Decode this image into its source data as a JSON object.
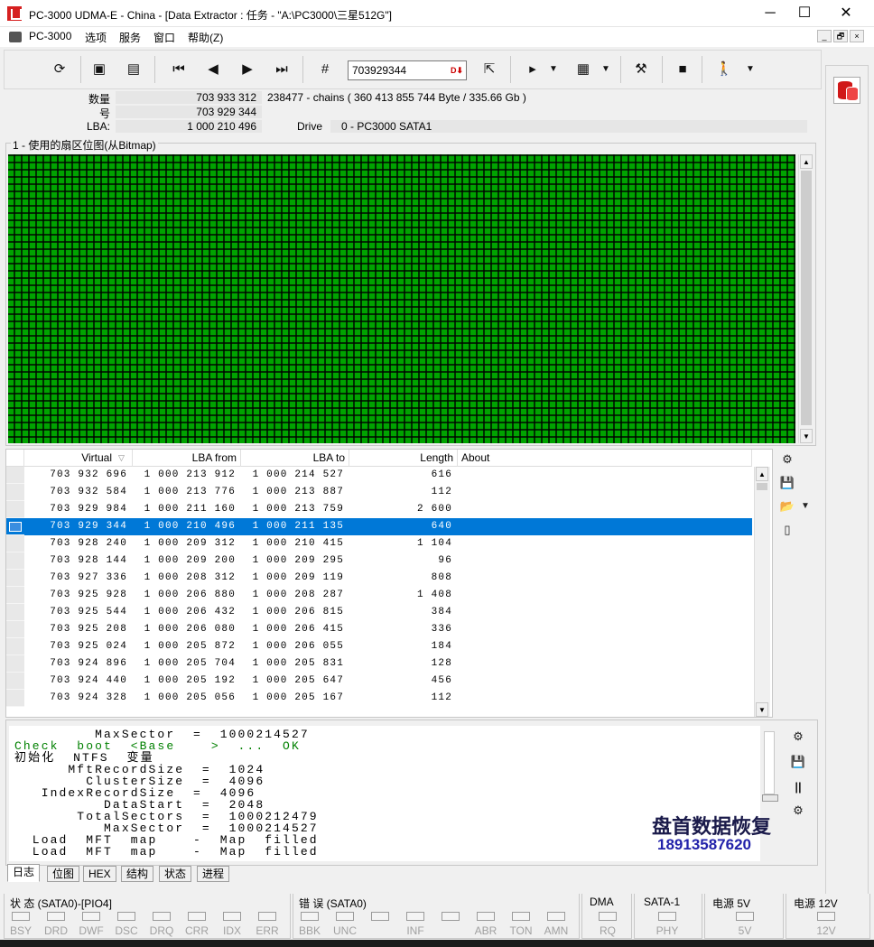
{
  "window": {
    "title": "PC-3000 UDMA-E - China - [Data Extractor : 任务 - \"A:\\PC3000\\三星512G\"]",
    "minimize": "─",
    "maximize": "☐",
    "close": "✕"
  },
  "menu": {
    "items": [
      "PC-3000",
      "选项",
      "服务",
      "窗口",
      "帮助(Z)"
    ],
    "mdi": [
      "_",
      "🗗",
      "×"
    ]
  },
  "toolbar": {
    "goto_value": "703929344",
    "goto_icon": "D⬇",
    "icons": [
      "refresh-scan-icon",
      "save-disk-icon",
      "save-disk-multi-icon",
      "first-icon",
      "prev-icon",
      "next-icon",
      "last-icon",
      "goto-number-icon",
      "export-icon",
      "play-icon",
      "grid-icon",
      "tools-icon",
      "stop-icon",
      "exit-icon"
    ]
  },
  "info": {
    "count_label": "数量",
    "count_value": "703 933 312",
    "count_extra": "238477 - chains  ( 360 413 855 744 Byte /  335.66 Gb )",
    "num_label": "号",
    "num_value": "703 929 344",
    "lba_label": "LBA:",
    "lba_value": "1 000 210 496",
    "drive_label": "Drive",
    "drive_value": "0 - PC3000 SATA1"
  },
  "bitmap": {
    "title": "1 - 使用的扇区位图(从Bitmap)",
    "fill_fraction": 1.0,
    "color": "#00cc00"
  },
  "table": {
    "columns": [
      "Virtual",
      "LBA from",
      "LBA to",
      "Length",
      "About"
    ],
    "selected_index": 3,
    "rows": [
      [
        "703 932 696",
        "1 000 213 912",
        "1 000 214 527",
        "616",
        ""
      ],
      [
        "703 932 584",
        "1 000 213 776",
        "1 000 213 887",
        "112",
        ""
      ],
      [
        "703 929 984",
        "1 000 211 160",
        "1 000 213 759",
        "2 600",
        ""
      ],
      [
        "703 929 344",
        "1 000 210 496",
        "1 000 211 135",
        "640",
        ""
      ],
      [
        "703 928 240",
        "1 000 209 312",
        "1 000 210 415",
        "1 104",
        ""
      ],
      [
        "703 928 144",
        "1 000 209 200",
        "1 000 209 295",
        "96",
        ""
      ],
      [
        "703 927 336",
        "1 000 208 312",
        "1 000 209 119",
        "808",
        ""
      ],
      [
        "703 925 928",
        "1 000 206 880",
        "1 000 208 287",
        "1 408",
        ""
      ],
      [
        "703 925 544",
        "1 000 206 432",
        "1 000 206 815",
        "384",
        ""
      ],
      [
        "703 925 208",
        "1 000 206 080",
        "1 000 206 415",
        "336",
        ""
      ],
      [
        "703 925 024",
        "1 000 205 872",
        "1 000 206 055",
        "184",
        ""
      ],
      [
        "703 924 896",
        "1 000 205 704",
        "1 000 205 831",
        "128",
        ""
      ],
      [
        "703 924 440",
        "1 000 205 192",
        "1 000 205 647",
        "456",
        ""
      ],
      [
        "703 924 328",
        "1 000 205 056",
        "1 000 205 167",
        "112",
        ""
      ]
    ]
  },
  "log": {
    "lines": [
      {
        "text": "         MaxSector  =  1000214527",
        "color": "black"
      },
      {
        "text": "Check  boot  <Base    >  ...  OK",
        "color": "green"
      },
      {
        "text": "初始化  NTFS  变量",
        "color": "black"
      },
      {
        "text": "      MftRecordSize  =  1024",
        "color": "black"
      },
      {
        "text": "        ClusterSize  =  4096",
        "color": "black"
      },
      {
        "text": "   IndexRecordSize  =  4096",
        "color": "black"
      },
      {
        "text": "          DataStart  =  2048",
        "color": "black"
      },
      {
        "text": "       TotalSectors  =  1000212479",
        "color": "black"
      },
      {
        "text": "          MaxSector  =  1000214527",
        "color": "black"
      },
      {
        "text": "  Load  MFT  map    -  Map  filled",
        "color": "black"
      },
      {
        "text": "  Load  MFT  map    -  Map  filled",
        "color": "black"
      }
    ],
    "pause": "||"
  },
  "watermark": {
    "line1": "盘首数据恢复",
    "line2": "18913587620"
  },
  "tabs": [
    "日志",
    "位图",
    "HEX",
    "结构",
    "状态",
    "进程"
  ],
  "status": {
    "state_title": "状 态 (SATA0)-[PIO4]",
    "state_leds": [
      "BSY",
      "DRD",
      "DWF",
      "DSC",
      "DRQ",
      "CRR",
      "IDX",
      "ERR"
    ],
    "error_title": "错 误 (SATA0)",
    "error_leds": [
      "BBK",
      "UNC",
      "",
      "INF",
      "",
      "ABR",
      "TON",
      "AMN"
    ],
    "dma_title": "DMA",
    "dma_leds": [
      "RQ"
    ],
    "sata_title": "SATA-1",
    "sata_leds": [
      "PHY"
    ],
    "p5_title": "电源 5V",
    "p5_leds": [
      "5V"
    ],
    "p12_title": "电源 12V",
    "p12_leds": [
      "12V"
    ]
  }
}
